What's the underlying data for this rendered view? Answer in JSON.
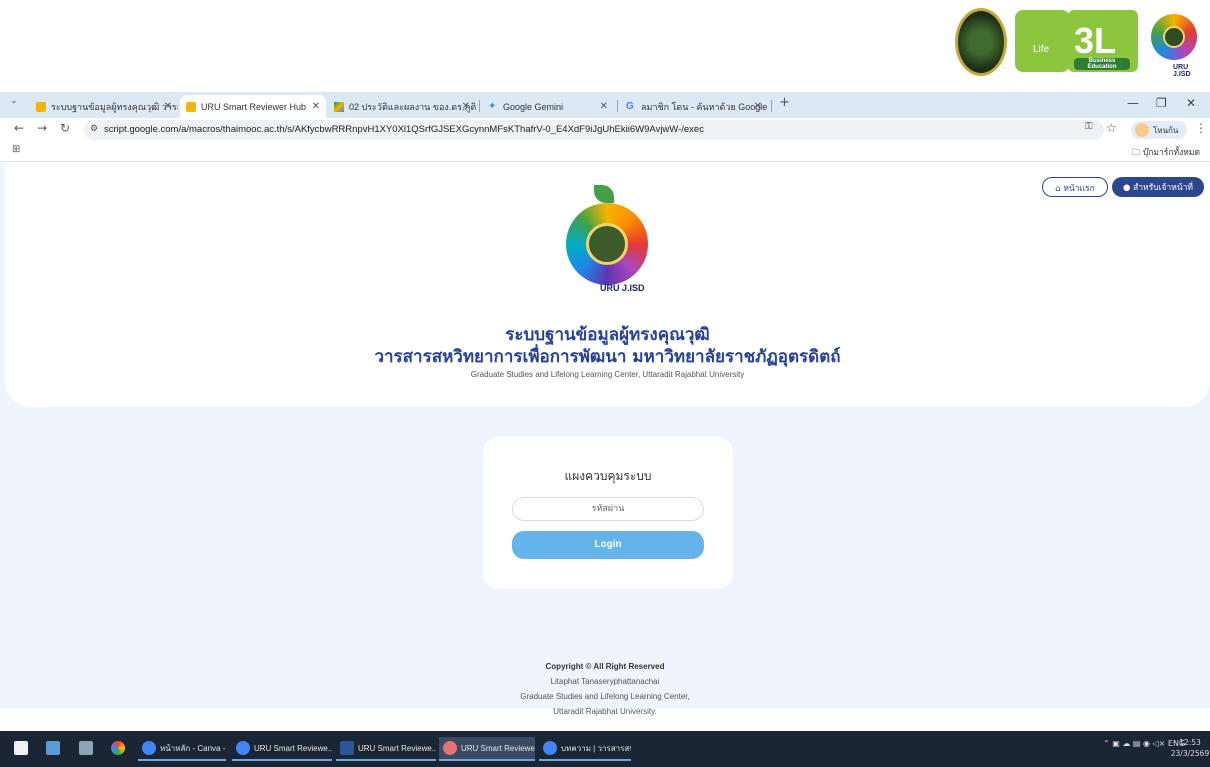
{
  "tabs": [
    {
      "label": "ระบบฐานข้อมูลผู้ทรงคุณวุฒิ วารสารฯ"
    },
    {
      "label": "URU Smart Reviewer Hub"
    },
    {
      "label": "02 ประวัติและผลงาน ของ.ดร.ภูติพงศ์ ภู"
    },
    {
      "label": "Google Gemini"
    },
    {
      "label": "ลมาชิก โดน - ค้นหาด้วย Google"
    }
  ],
  "browser": {
    "url": "script.google.com/a/macros/thaimooc.ac.th/s/AKfycbwRRRnpvH1XY0Xl1QSrfGJSEXGcynnMFsKThafrV-0_E4XdF9iJgUhEkii6W9AvjwW-/exec",
    "profile": "โหนก้น",
    "bookmark_folder": "บุ๊กมาร์กทั้งหมด"
  },
  "logos": {
    "life": "Life",
    "three_l": "3L",
    "three_l_sub": "Business Education",
    "jisd": "URU J.ISD"
  },
  "header": {
    "home_button": "หน้าแรก",
    "staff_button": "สำหรับเจ้าหน้าที่",
    "logo_label": "URU J.ISD",
    "title_line1": "ระบบฐานข้อมูลผู้ทรงคุณวุฒิ",
    "title_line2": "วารสารสหวิทยาการเพื่อการพัฒนา มหาวิทยาลัยราชภัฏอุตรดิตถ์",
    "subtitle": "Graduate Studies and Lifelong Learning Center, Uttaradit Rajabhat University"
  },
  "login": {
    "title": "แผงควบคุมระบบ",
    "password_placeholder": "รหัสผ่าน",
    "button": "Login"
  },
  "footer": {
    "copyright": "Copyright © All Right Reserved",
    "author": "Litaphat Tanaseryphattanachai",
    "org1": "Graduate Studies and Lifelong Learning Center,",
    "org2": "Uttaradit Rajabhat University."
  },
  "taskbar": {
    "apps": [
      {
        "label": "หน้าหลัก - Canva - G..."
      },
      {
        "label": "URU Smart Reviewe..."
      },
      {
        "label": "URU Smart Reviewe..."
      },
      {
        "label": "URU Smart Reviewe..."
      },
      {
        "label": "บทความ | วารสารสหวิท..."
      }
    ],
    "lang": "ENG",
    "time": "12:53",
    "date": "23/3/2569"
  },
  "colors": {
    "primary": "#2d4690",
    "login_button": "#64b3ea",
    "page_bg": "#eef5fd",
    "title": "#26409b"
  }
}
